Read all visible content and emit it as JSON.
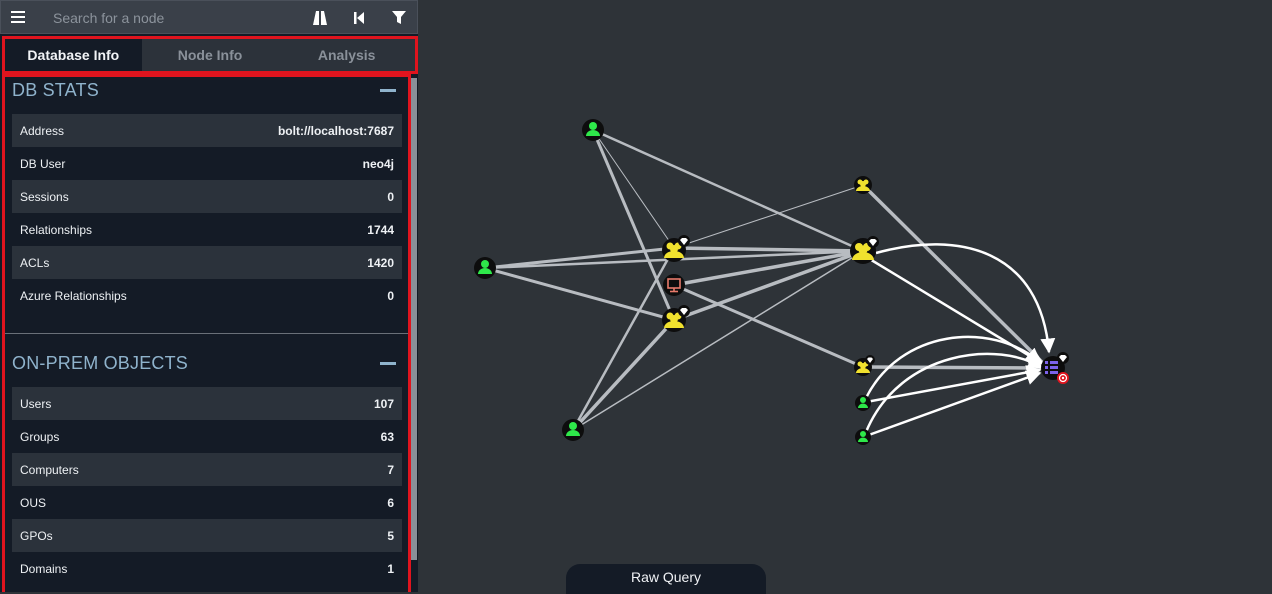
{
  "search": {
    "placeholder": "Search for a node"
  },
  "tabs": [
    {
      "label": "Database Info"
    },
    {
      "label": "Node Info"
    },
    {
      "label": "Analysis"
    }
  ],
  "db_stats": {
    "title": "DB STATS",
    "rows": [
      {
        "label": "Address",
        "value": "bolt://localhost:7687"
      },
      {
        "label": "DB User",
        "value": "neo4j"
      },
      {
        "label": "Sessions",
        "value": "0"
      },
      {
        "label": "Relationships",
        "value": "1744"
      },
      {
        "label": "ACLs",
        "value": "1420"
      },
      {
        "label": "Azure Relationships",
        "value": "0"
      }
    ]
  },
  "onprem": {
    "title": "ON-PREM OBJECTS",
    "rows": [
      {
        "label": "Users",
        "value": "107"
      },
      {
        "label": "Groups",
        "value": "63"
      },
      {
        "label": "Computers",
        "value": "7"
      },
      {
        "label": "OUS",
        "value": "6"
      },
      {
        "label": "GPOs",
        "value": "5"
      },
      {
        "label": "Domains",
        "value": "1"
      }
    ]
  },
  "raw_query": {
    "label": "Raw Query"
  },
  "colors": {
    "user": "#2ee84a",
    "group": "#f0e12e",
    "computer": "#e87a6b",
    "domain": "#7b62e8",
    "target": "#e0141e",
    "highlight": "#e0141e"
  },
  "icons": [
    "menu-icon",
    "pathfinding-icon",
    "back-icon",
    "filter-icon"
  ]
}
